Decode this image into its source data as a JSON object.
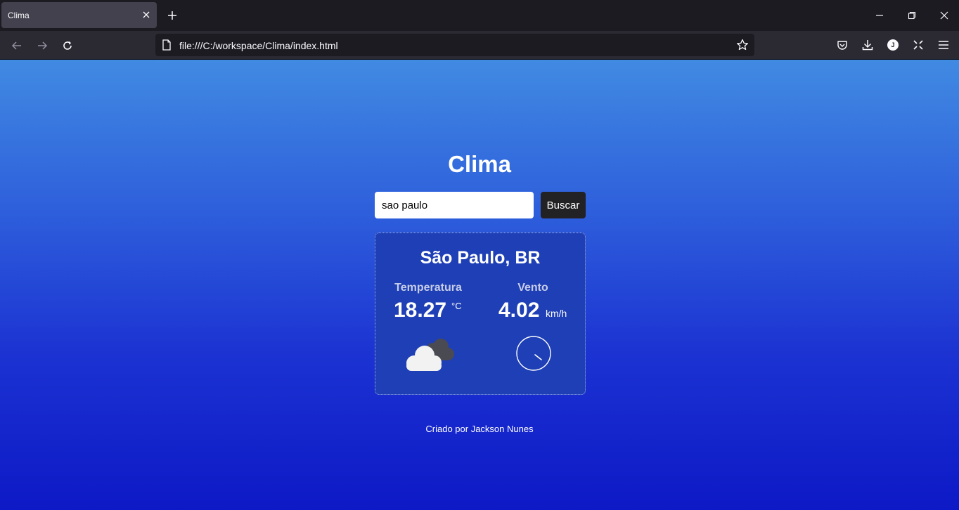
{
  "browser": {
    "tab_title": "Clima",
    "url": "file:///C:/workspace/Clima/index.html",
    "profile_initial": "J"
  },
  "app": {
    "title": "Clima",
    "search": {
      "value": "sao paulo",
      "button_label": "Buscar"
    },
    "result": {
      "city": "São Paulo, BR",
      "temperature_label": "Temperatura",
      "temperature_value": "18.27",
      "temperature_unit": "°C",
      "wind_label": "Vento",
      "wind_value": "4.02",
      "wind_unit": "km/h",
      "weather_icon": "cloudy-icon",
      "wind_direction_icon": "wind-direction-dial-icon"
    },
    "footer": "Criado por Jackson Nunes"
  },
  "colors": {
    "gradient_top": "#418ae2",
    "gradient_bottom": "#0d19c6",
    "card_bg": "#1e3fb5",
    "button_bg": "#222225"
  }
}
